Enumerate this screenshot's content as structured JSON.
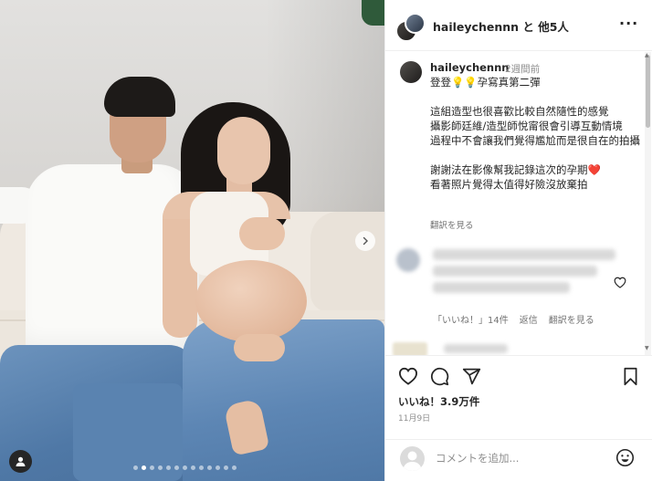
{
  "header": {
    "username": "haileychennn",
    "suffix": " と 他5人",
    "more_icon": "···"
  },
  "caption": {
    "username": "haileychennn",
    "time": "2週間前",
    "body": "登登💡💡孕寫真第二彈\n\n這組造型也很喜歡比較自然隨性的感覺\n攝影師廷維/造型師悅甯很會引導互動情境\n過程中不會讓我們覺得尷尬而是很自在的拍攝\n\n謝謝法在影像幫我記錄這次的孕期❤️\n看著照片覺得太值得好險沒放棄拍",
    "translate": "翻訳を見る"
  },
  "comment": {
    "likes_label": "「いいね！」14件",
    "reply_label": "返信",
    "translate_label": "翻訳を見る"
  },
  "post": {
    "likes": "いいね！3.9万件",
    "date": "11月9日"
  },
  "add_comment": {
    "placeholder": "コメントを追加..."
  },
  "carousel": {
    "slide_count": 13,
    "active_index": 1
  },
  "icons": {
    "heart": "heart-icon",
    "comment": "comment-icon",
    "share": "share-icon",
    "bookmark": "bookmark-icon",
    "emoji": "emoji-icon",
    "next": "chevron-right-icon",
    "tag": "user-tag-icon"
  },
  "colors": {
    "text": "#262626",
    "muted": "#8e8e8e",
    "border": "#efefef",
    "heart_emoji": "#ed4956"
  }
}
